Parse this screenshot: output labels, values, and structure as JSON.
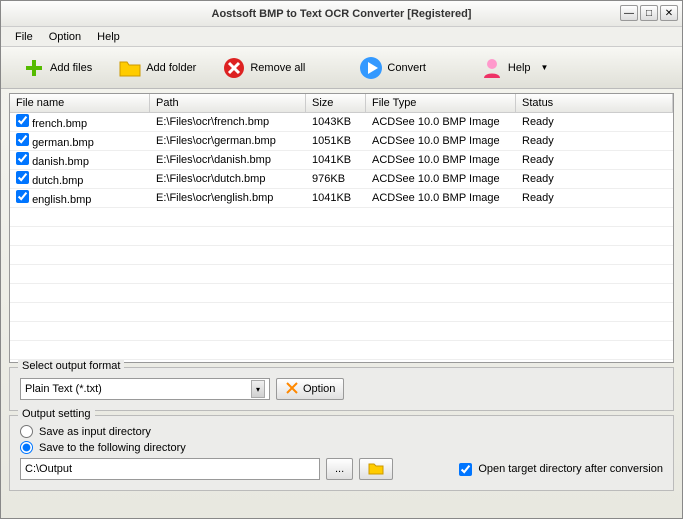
{
  "window": {
    "title": "Aostsoft BMP to Text OCR Converter [Registered]"
  },
  "menus": {
    "file": "File",
    "option": "Option",
    "help": "Help"
  },
  "toolbar": {
    "add_files": "Add files",
    "add_folder": "Add folder",
    "remove_all": "Remove all",
    "convert": "Convert",
    "help": "Help"
  },
  "columns": {
    "name": "File name",
    "path": "Path",
    "size": "Size",
    "type": "File Type",
    "status": "Status"
  },
  "files": [
    {
      "checked": true,
      "name": "french.bmp",
      "path": "E:\\Files\\ocr\\french.bmp",
      "size": "1043KB",
      "type": "ACDSee 10.0 BMP Image",
      "status": "Ready"
    },
    {
      "checked": true,
      "name": "german.bmp",
      "path": "E:\\Files\\ocr\\german.bmp",
      "size": "1051KB",
      "type": "ACDSee 10.0 BMP Image",
      "status": "Ready"
    },
    {
      "checked": true,
      "name": "danish.bmp",
      "path": "E:\\Files\\ocr\\danish.bmp",
      "size": "1041KB",
      "type": "ACDSee 10.0 BMP Image",
      "status": "Ready"
    },
    {
      "checked": true,
      "name": "dutch.bmp",
      "path": "E:\\Files\\ocr\\dutch.bmp",
      "size": "976KB",
      "type": "ACDSee 10.0 BMP Image",
      "status": "Ready"
    },
    {
      "checked": true,
      "name": "english.bmp",
      "path": "E:\\Files\\ocr\\english.bmp",
      "size": "1041KB",
      "type": "ACDSee 10.0 BMP Image",
      "status": "Ready"
    }
  ],
  "format": {
    "legend": "Select output format",
    "selected": "Plain Text (*.txt)",
    "option_btn": "Option"
  },
  "output": {
    "legend": "Output setting",
    "save_as_input": "Save as input directory",
    "save_to_following": "Save to the following directory",
    "path": "C:\\Output",
    "browse": "...",
    "open_after": "Open target directory after conversion"
  }
}
